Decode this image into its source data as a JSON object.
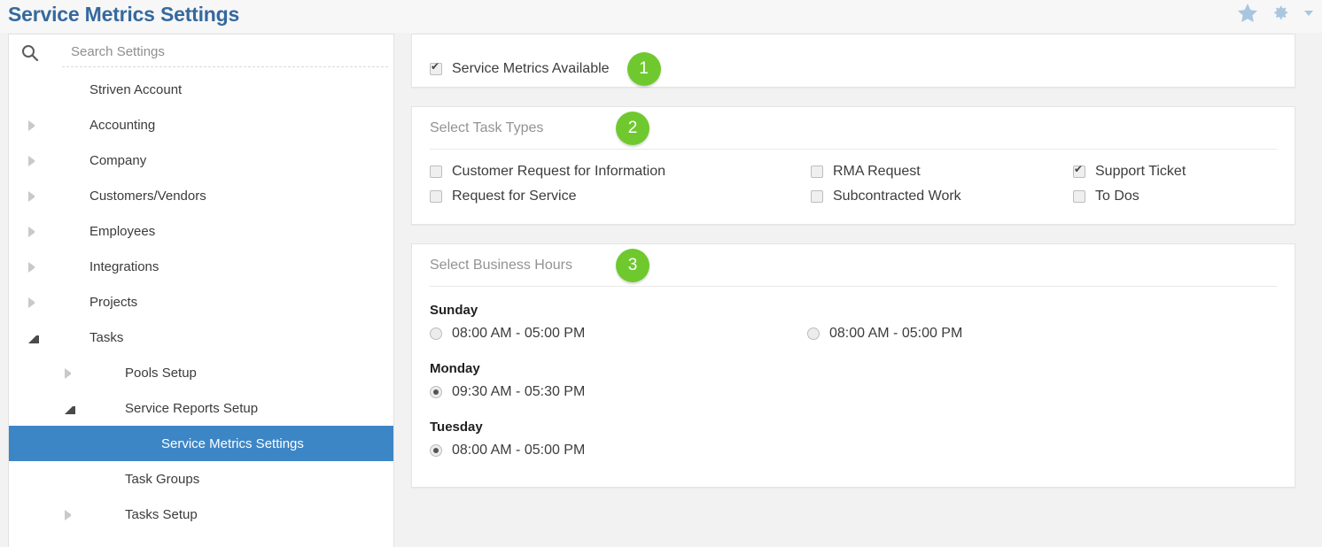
{
  "header": {
    "title": "Service Metrics Settings",
    "icons": [
      {
        "name": "favorite-star-icon"
      },
      {
        "name": "gear-icon"
      },
      {
        "name": "chevron-down-icon"
      }
    ]
  },
  "sidebar": {
    "search": {
      "placeholder": "Search Settings",
      "value": "",
      "icon": "search-icon"
    },
    "items": [
      {
        "label": "Striven Account",
        "level": 0,
        "arrow": "none",
        "selected": false
      },
      {
        "label": "Accounting",
        "level": 0,
        "arrow": "collapsed",
        "selected": false
      },
      {
        "label": "Company",
        "level": 0,
        "arrow": "collapsed",
        "selected": false
      },
      {
        "label": "Customers/Vendors",
        "level": 0,
        "arrow": "collapsed",
        "selected": false
      },
      {
        "label": "Employees",
        "level": 0,
        "arrow": "collapsed",
        "selected": false
      },
      {
        "label": "Integrations",
        "level": 0,
        "arrow": "collapsed",
        "selected": false
      },
      {
        "label": "Projects",
        "level": 0,
        "arrow": "collapsed",
        "selected": false
      },
      {
        "label": "Tasks",
        "level": 0,
        "arrow": "expanded",
        "selected": false
      },
      {
        "label": "Pools Setup",
        "level": 1,
        "arrow": "collapsed",
        "selected": false
      },
      {
        "label": "Service Reports Setup",
        "level": 1,
        "arrow": "expanded",
        "selected": false
      },
      {
        "label": "Service Metrics Settings",
        "level": 2,
        "arrow": "none",
        "selected": true
      },
      {
        "label": "Task Groups",
        "level": 1,
        "arrow": "none",
        "selected": false
      },
      {
        "label": "Tasks Setup",
        "level": 1,
        "arrow": "collapsed",
        "selected": false
      }
    ]
  },
  "main": {
    "available": {
      "label": "Service Metrics Available",
      "checked": true,
      "badge": "1"
    },
    "task_types": {
      "title": "Select Task Types",
      "badge": "2",
      "options": [
        {
          "label": "Customer Request for Information",
          "checked": false,
          "col": 1,
          "row": 1
        },
        {
          "label": "RMA Request",
          "checked": false,
          "col": 2,
          "row": 1
        },
        {
          "label": "Support Ticket",
          "checked": true,
          "col": 3,
          "row": 1
        },
        {
          "label": "Request for Service",
          "checked": false,
          "col": 1,
          "row": 2
        },
        {
          "label": "Subcontracted Work",
          "checked": false,
          "col": 2,
          "row": 2
        },
        {
          "label": "To Dos",
          "checked": false,
          "col": 3,
          "row": 2
        }
      ]
    },
    "business_hours": {
      "title": "Select Business Hours",
      "badge": "3",
      "days": [
        {
          "name": "Sunday",
          "slots": [
            {
              "label": "08:00 AM - 05:00 PM",
              "selected": false
            },
            {
              "label": "08:00 AM - 05:00 PM",
              "selected": false
            }
          ]
        },
        {
          "name": "Monday",
          "slots": [
            {
              "label": "09:30 AM - 05:30 PM",
              "selected": true
            }
          ]
        },
        {
          "name": "Tuesday",
          "slots": [
            {
              "label": "08:00 AM - 05:00 PM",
              "selected": true
            }
          ]
        }
      ]
    }
  },
  "colors": {
    "title_blue": "#35699e",
    "selected_blue": "#3d86c6",
    "badge_green": "#6fc92e",
    "page_background": "#f2f2f2"
  }
}
